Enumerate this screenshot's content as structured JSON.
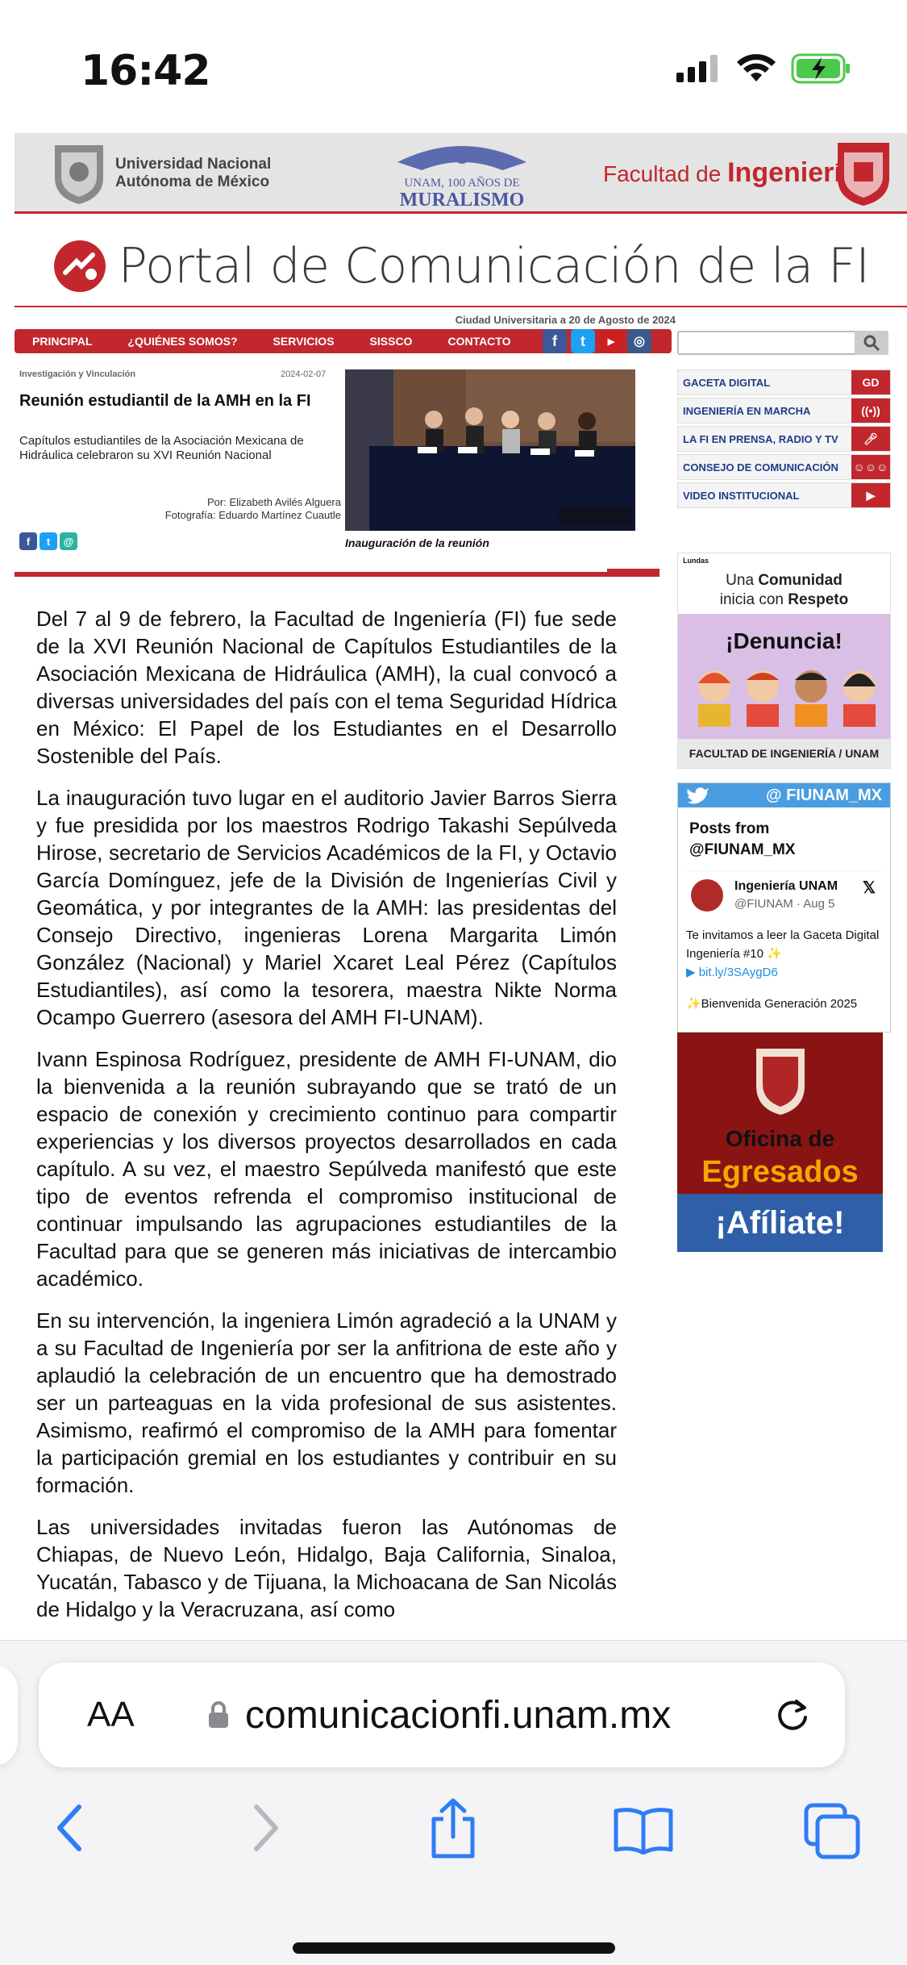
{
  "status": {
    "time": "16:42"
  },
  "header": {
    "unam_line1": "Universidad Nacional",
    "unam_line2": "Autónoma de México",
    "mural_line1": "UNAM, 100 AÑOS DE",
    "mural_line2": "MURALISMO",
    "faculty_prefix": "Facultad de ",
    "faculty_bold": "Ingeniería",
    "portal_title": "Portal de Comunicación de la FI",
    "date_line": "Ciudad Universitaria a 20 de Agosto de 2024"
  },
  "nav": {
    "items": [
      "PRINCIPAL",
      "¿QUIÉNES SOMOS?",
      "SERVICIOS",
      "SISSCO",
      "CONTACTO"
    ]
  },
  "article": {
    "category": "Investigación y Vinculación",
    "date": "2024-02-07",
    "title": "Reunión estudiantil de la AMH en la FI",
    "subtitle": "Capítulos estudiantiles de la Asociación Mexicana de Hidráulica celebraron su XVI Reunión Nacional",
    "author": "Por: Elizabeth Avilés Alguera",
    "photo_credit": "Fotografía: Eduardo Martínez Cuautle",
    "caption": "Inauguración de la reunión",
    "paragraphs": [
      "Del 7 al 9 de febrero, la Facultad de Ingeniería (FI) fue sede de la XVI Reunión Nacional de Capítulos Estudiantiles de la Asociación Mexicana de Hidráulica (AMH), la cual convocó a diversas universidades del país con el tema Seguridad Hídrica en México: El Papel de los Estudiantes en el Desarrollo Sostenible del País.",
      "La inauguración tuvo lugar en el auditorio Javier Barros Sierra y fue presidida por los maestros Rodrigo Takashi Sepúlveda Hirose, secretario de Servicios Académicos de la FI, y Octavio García Domínguez, jefe de la División de Ingenierías Civil y Geomática, y por integrantes de la AMH: las presidentas del Consejo Directivo, ingenieras Lorena Margarita Limón González (Nacional) y Mariel Xcaret Leal Pérez (Capítulos Estudiantiles), así como la tesorera, maestra Nikte Norma Ocampo Guerrero (asesora del AMH FI-UNAM).",
      "Ivann Espinosa Rodríguez, presidente de AMH FI-UNAM, dio la bienvenida a la reunión subrayando que se trató de un espacio de conexión y crecimiento continuo para compartir experiencias y los diversos proyectos desarrollados en cada capítulo. A su vez, el maestro Sepúlveda manifestó que este tipo de eventos refrenda el compromiso institucional de continuar impulsando las agrupaciones estudiantiles de la Facultad para que se generen más iniciativas de intercambio académico.",
      "En su intervención, la ingeniera Limón agradeció a la UNAM y a su Facultad de Ingeniería por ser la anfitriona de este año y aplaudió la celebración de un encuentro que ha demostrado ser un parteaguas en la vida profesional de sus asistentes. Asimismo, reafirmó el compromiso de la AMH para fomentar la participación gremial en los estudiantes y contribuir en su formación.",
      "Las universidades invitadas fueron las Autónomas de Chiapas, de Nuevo León, Hidalgo, Baja California, Sinaloa, Yucatán, Tabasco y de Tijuana, la Michoacana de San Nicolás de Hidalgo y la Veracruzana, así como"
    ]
  },
  "sidebar": {
    "menu": [
      "GACETA DIGITAL",
      "INGENIERÍA EN MARCHA",
      "LA FI EN PRENSA, RADIO Y TV",
      "CONSEJO DE COMUNICACIÓN",
      "VIDEO INSTITUCIONAL"
    ],
    "gd_badge": "GD",
    "respect": {
      "brand": "Lundas",
      "line1_prefix": "Una ",
      "line1_bold": "Comunidad",
      "line2_prefix": "inicia con ",
      "line2_bold": "Respeto",
      "denuncia": "¡Denuncia!",
      "footer": "FACULTAD DE INGENIERÍA / UNAM"
    },
    "twitter": {
      "header": "@ FIUNAM_MX",
      "posts_from": "Posts from @FIUNAM_MX",
      "name": "Ingeniería UNAM",
      "handle": "@FIUNAM · Aug 5",
      "text": "Te invitamos a leer la Gaceta Digital Ingeniería #10 ✨",
      "link": "bit.ly/3SAygD6",
      "text2": "✨Bienvenida Generación 2025"
    },
    "egresados": {
      "line1": "Oficina de",
      "line2": "Egresados",
      "cta": "¡Afíliate!"
    }
  },
  "browser": {
    "aa": "AA",
    "url": "comunicacionfi.unam.mx"
  },
  "colors": {
    "accent": "#c1272d",
    "nav_text": "#ffffff",
    "link_blue": "#1f3c88",
    "ios_blue": "#2f7cf6"
  }
}
